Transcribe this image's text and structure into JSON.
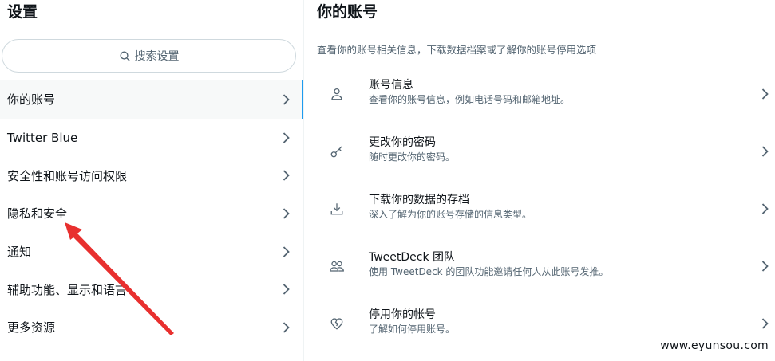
{
  "settings": {
    "title": "设置",
    "search_placeholder": "搜索设置",
    "menu": [
      {
        "label": "你的账号",
        "active": true
      },
      {
        "label": "Twitter Blue"
      },
      {
        "label": "安全性和账号访问权限"
      },
      {
        "label": "隐私和安全"
      },
      {
        "label": "通知"
      },
      {
        "label": "辅助功能、显示和语言"
      },
      {
        "label": "更多资源"
      }
    ]
  },
  "account": {
    "title": "你的账号",
    "description": "查看你的账号相关信息，下载数据档案或了解你的账号停用选项",
    "rows": [
      {
        "icon": "person-icon",
        "title": "账号信息",
        "desc": "查看你的账号信息，例如电话号码和邮箱地址。"
      },
      {
        "icon": "key-icon",
        "title": "更改你的密码",
        "desc": "随时更改你的密码。"
      },
      {
        "icon": "download-icon",
        "title": "下载你的数据的存档",
        "desc": "深入了解为你的账号存储的信息类型。"
      },
      {
        "icon": "people-icon",
        "title": "TweetDeck 团队",
        "desc": "使用 TweetDeck 的团队功能邀请任何人从此账号发推。"
      },
      {
        "icon": "broken-heart-icon",
        "title": "停用你的帐号",
        "desc": "了解如何停用账号。"
      }
    ]
  },
  "watermark": "www.eyunsou.com",
  "colors": {
    "accent": "#1d9bf0",
    "arrow": "#e8302f"
  }
}
